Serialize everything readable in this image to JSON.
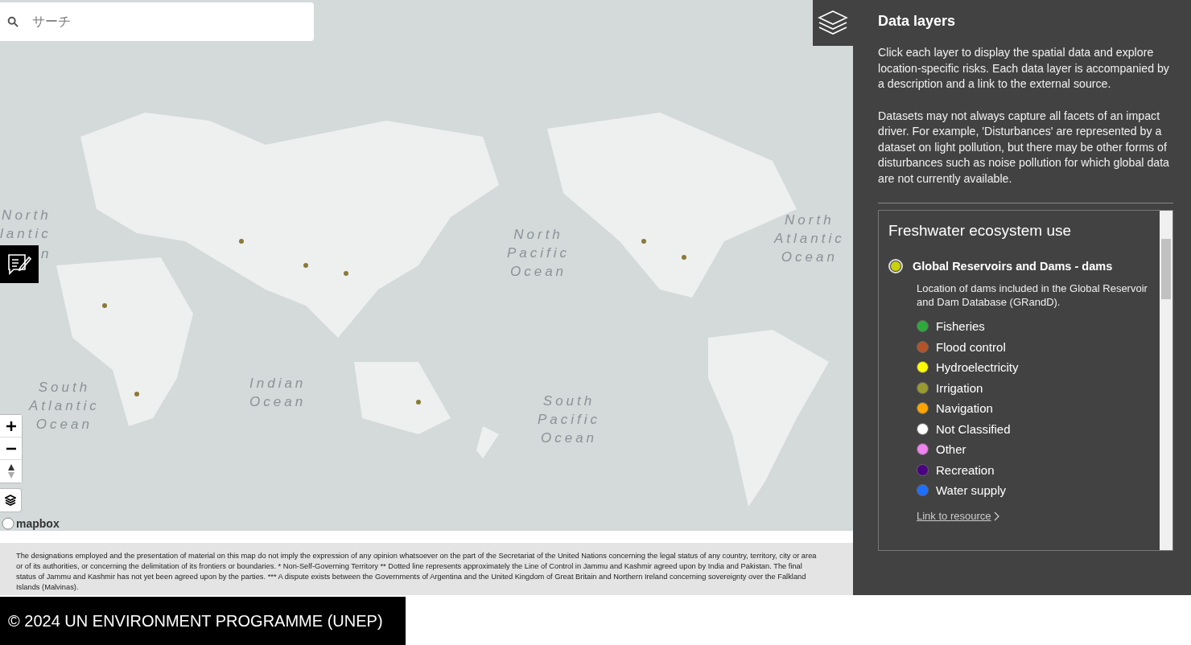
{
  "search": {
    "placeholder": "サーチ"
  },
  "map": {
    "ocean_labels": [
      {
        "lines": [
          "North",
          "lantic"
        ]
      },
      {
        "lines": [
          "n"
        ]
      },
      {
        "lines": [
          "North",
          "Pacific",
          "Ocean"
        ]
      },
      {
        "lines": [
          "North",
          "Atlantic",
          "Ocean"
        ]
      },
      {
        "lines": [
          "South",
          "Atlantic",
          "Ocean"
        ]
      },
      {
        "lines": [
          "Indian",
          "Ocean"
        ]
      },
      {
        "lines": [
          "South",
          "Pacific",
          "Ocean"
        ]
      }
    ],
    "attribution": "mapbox"
  },
  "disclaimer": "The designations employed and the presentation of material on this map do not imply the expression of any opinion whatsoever on the part of the Secretariat of the United Nations concerning the legal status of any country, territory, city or area or of its authorities, or concerning the delimitation of its frontiers or boundaries. * Non-Self-Governing Territory ** Dotted line represents approximately the Line of Control in Jammu and Kashmir agreed upon by India and Pakistan. The final status of Jammu and Kashmir has not yet been agreed upon by the parties. *** A dispute exists between the Governments of Argentina and the United Kingdom of Great Britain and Northern Ireland concerning sovereignty over the Falkland Islands (Malvinas).",
  "footer": "© 2024 UN ENVIRONMENT PROGRAMME (UNEP)",
  "panel": {
    "title": "Data layers",
    "intro": [
      "Click each layer to display the spatial data and explore location-specific risks. Each data layer is accompanied by a description and a link to the external source.",
      "Datasets may not always capture all facets of an impact driver. For example, 'Disturbances' are represented by a dataset on light pollution, but there may be other forms of disturbances such as noise pollution for which global data are not currently available."
    ],
    "section": {
      "title": "Freshwater ecosystem use",
      "layer": {
        "name": "Global Reservoirs and Dams - dams",
        "selected": true,
        "description": "Location of dams included in the Global Reservoir and Dam Database (GRandD).",
        "legend": [
          {
            "label": "Fisheries",
            "color": "#2eaa3c"
          },
          {
            "label": "Flood control",
            "color": "#b4532a"
          },
          {
            "label": "Hydroelectricity",
            "color": "#ffff00"
          },
          {
            "label": "Irrigation",
            "color": "#9a9a32"
          },
          {
            "label": "Navigation",
            "color": "#ffa500"
          },
          {
            "label": "Not Classified",
            "color": "#ffffff"
          },
          {
            "label": "Other",
            "color": "#ee82ee"
          },
          {
            "label": "Recreation",
            "color": "#4b0082"
          },
          {
            "label": "Water supply",
            "color": "#1e6fff"
          }
        ],
        "link": "Link to resource"
      }
    }
  }
}
